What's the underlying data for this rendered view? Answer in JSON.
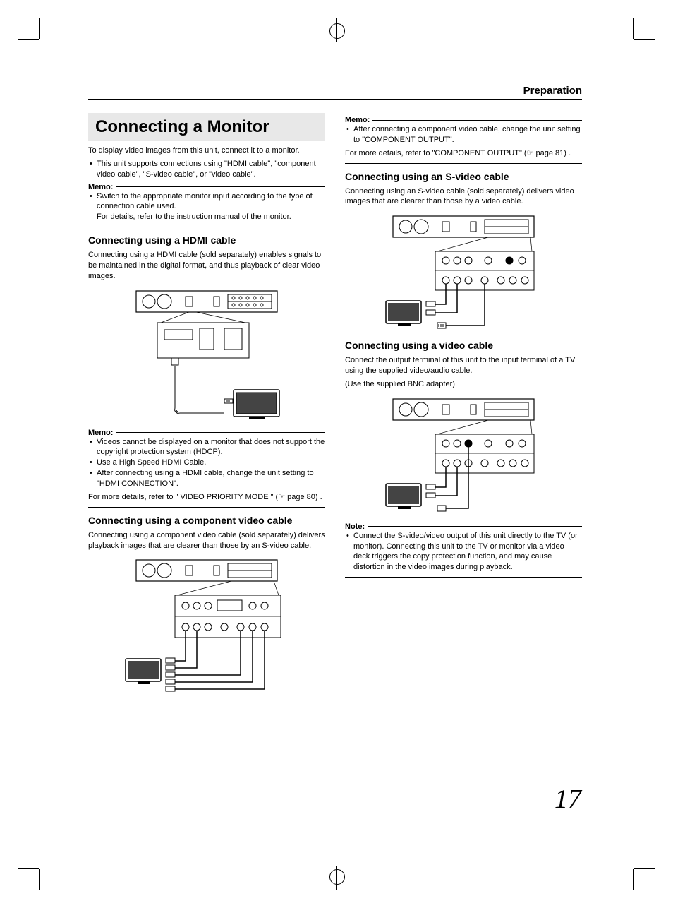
{
  "header": {
    "section": "Preparation"
  },
  "title": "Connecting a Monitor",
  "intro": "To display video images from this unit, connect it to a monitor.",
  "intro_bullets": [
    "This unit supports connections using \"HDMI cable\", \"component video cable\", \"S-video cable\", or \"video cable\"."
  ],
  "memo_label": "Memo:",
  "note_label": "Note:",
  "memo1": [
    "Switch to the appropriate monitor input according to the type of connection cable used.",
    "For details, refer to the instruction manual of the monitor."
  ],
  "hdmi": {
    "heading": "Connecting using a HDMI cable",
    "body": "Connecting using a HDMI cable (sold separately) enables signals to be maintained in the digital format, and thus playback of clear video images.",
    "memo": [
      "Videos cannot be displayed on a monitor that does not support the copyright protection system (HDCP).",
      "Use a High Speed HDMI Cable.",
      "After connecting using a HDMI cable, change the unit setting to \"HDMI CONNECTION\"."
    ],
    "footer": "For more details, refer to \" VIDEO PRIORITY MODE \" (☞ page 80) ."
  },
  "component": {
    "heading": "Connecting using a component video cable",
    "body": "Connecting using a component video cable (sold separately) delivers playback images that are clearer than those by an S-video cable.",
    "memo": [
      "After connecting a component video cable, change the unit setting to \"COMPONENT OUTPUT\"."
    ],
    "footer": "For more details, refer to \"COMPONENT OUTPUT\" (☞ page 81) ."
  },
  "svideo": {
    "heading": "Connecting using an S-video cable",
    "body": "Connecting using an S-video cable (sold separately) delivers video images that are clearer than those by a video cable."
  },
  "video": {
    "heading": "Connecting using a video cable",
    "body": "Connect the output terminal of this unit to the input terminal of a TV using the supplied video/audio cable.",
    "body2": "(Use the supplied BNC adapter)",
    "note": [
      "Connect the S-video/video output of this unit directly to the TV (or monitor). Connecting this unit to the TV or monitor via a video deck triggers the copy protection function, and may cause distortion in the video images during playback."
    ]
  },
  "page_number": "17"
}
